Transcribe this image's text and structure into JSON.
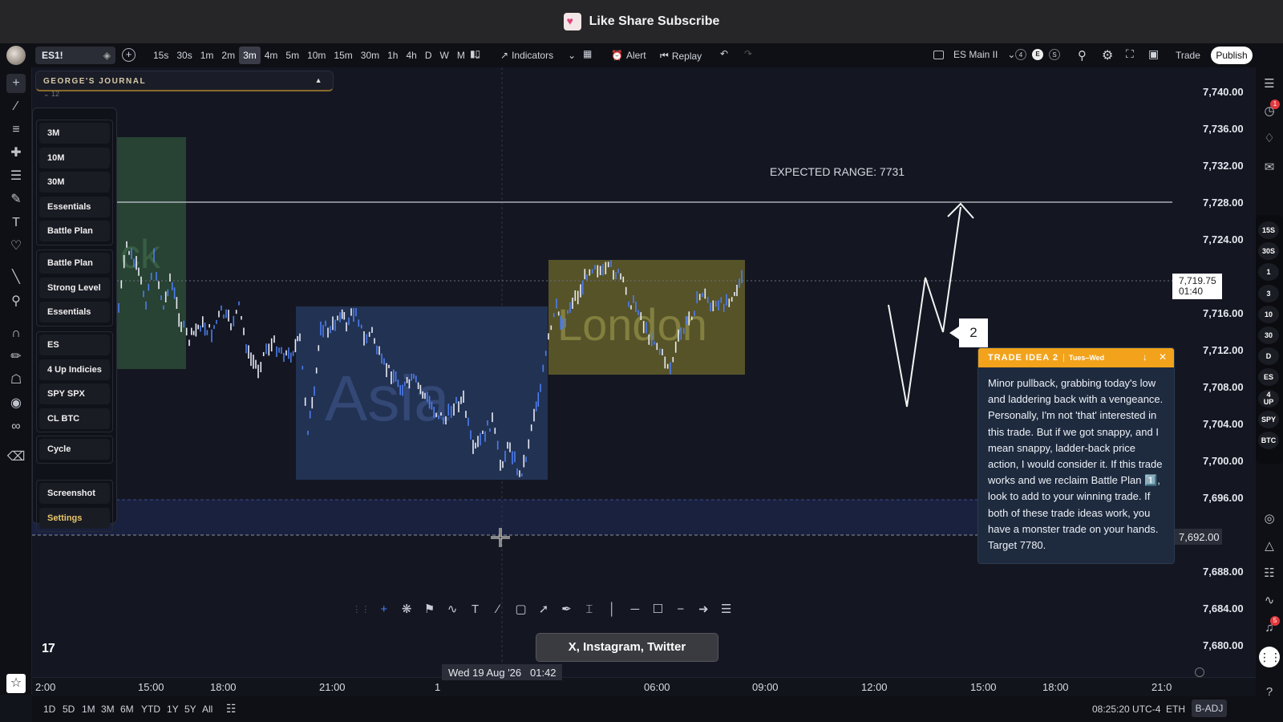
{
  "banner": {
    "title": "Like Share Subscribe"
  },
  "toolbar": {
    "symbol": "ES1!",
    "intervals": [
      "15s",
      "30s",
      "1m",
      "2m",
      "3m",
      "4m",
      "5m",
      "10m",
      "15m",
      "30m",
      "1h",
      "4h",
      "D",
      "W",
      "M"
    ],
    "active_interval": "3m",
    "indicators_label": "Indicators",
    "alert_label": "Alert",
    "replay_label": "Replay",
    "layout_name": "ES Main II",
    "badge_count": "4",
    "badge_e": "E",
    "badge_s": "S",
    "trade_label": "Trade",
    "publish_label": "Publish"
  },
  "journal": {
    "title": "GEORGE'S JOURNAL",
    "sub": "12",
    "groups": [
      [
        "3M",
        "10M",
        "30M",
        "Essentials",
        "Battle Plan"
      ],
      [
        "Battle Plan",
        "Strong Level",
        "Essentials"
      ],
      [
        "ES",
        "4 Up Indicies",
        "SPY SPX",
        "CL BTC"
      ],
      [
        "Cycle"
      ],
      [
        "Screenshot",
        "Settings"
      ]
    ]
  },
  "chart": {
    "expected_range": "EXPECTED RANGE: 7731",
    "session_asia": "Asia",
    "session_london": "London",
    "session_left": "ck",
    "callout_number": "2",
    "current_price": "7,719.75",
    "countdown": "01:40",
    "crosshair_price": "7,692.00",
    "crosshair_date": "Wed 19 Aug '26",
    "crosshair_time": "01:42",
    "social": "X, Instagram, Twitter"
  },
  "price_axis": [
    "7,740.00",
    "7,736.00",
    "7,732.00",
    "7,728.00",
    "7,724.00",
    "7,716.00",
    "7,712.00",
    "7,708.00",
    "7,704.00",
    "7,700.00",
    "7,696.00",
    "7,688.00",
    "7,684.00",
    "7,680.00"
  ],
  "time_axis": [
    "2:00",
    "15:00",
    "18:00",
    "21:00",
    "1",
    "06:00",
    "09:00",
    "12:00",
    "15:00",
    "18:00",
    "21:0"
  ],
  "trade_idea": {
    "title": "TRADE IDEA 2",
    "days": "Tues–Wed",
    "body": "Minor pullback, grabbing today's low and laddering back with a vengeance. Personally, I'm not 'that' interested in this trade. But if we got snappy, and I mean snappy, ladder-back price action, I would consider it. If this trade works and we reclaim Battle Plan 1️⃣, look to add to your winning trade. If both of these trade ideas work, you have a monster trade on your hands. Target 7780."
  },
  "right_buttons": [
    "15S",
    "30S",
    "1",
    "3",
    "10",
    "30",
    "D",
    "ES",
    "4\nUP",
    "SPY",
    "BTC"
  ],
  "bottom": {
    "ranges": [
      "1D",
      "5D",
      "1M",
      "3M",
      "6M",
      "YTD",
      "1Y",
      "5Y",
      "All"
    ],
    "clock": "08:25:20 UTC-4",
    "session": "ETH",
    "adj": "B-ADJ"
  },
  "notifications": {
    "alerts": "1",
    "messages": "5"
  },
  "colors": {
    "accent_orange": "#f2a31b",
    "asia_box": "#2a3a5e",
    "london_box": "#5a5a30",
    "card_bg": "#1e2a3e"
  }
}
